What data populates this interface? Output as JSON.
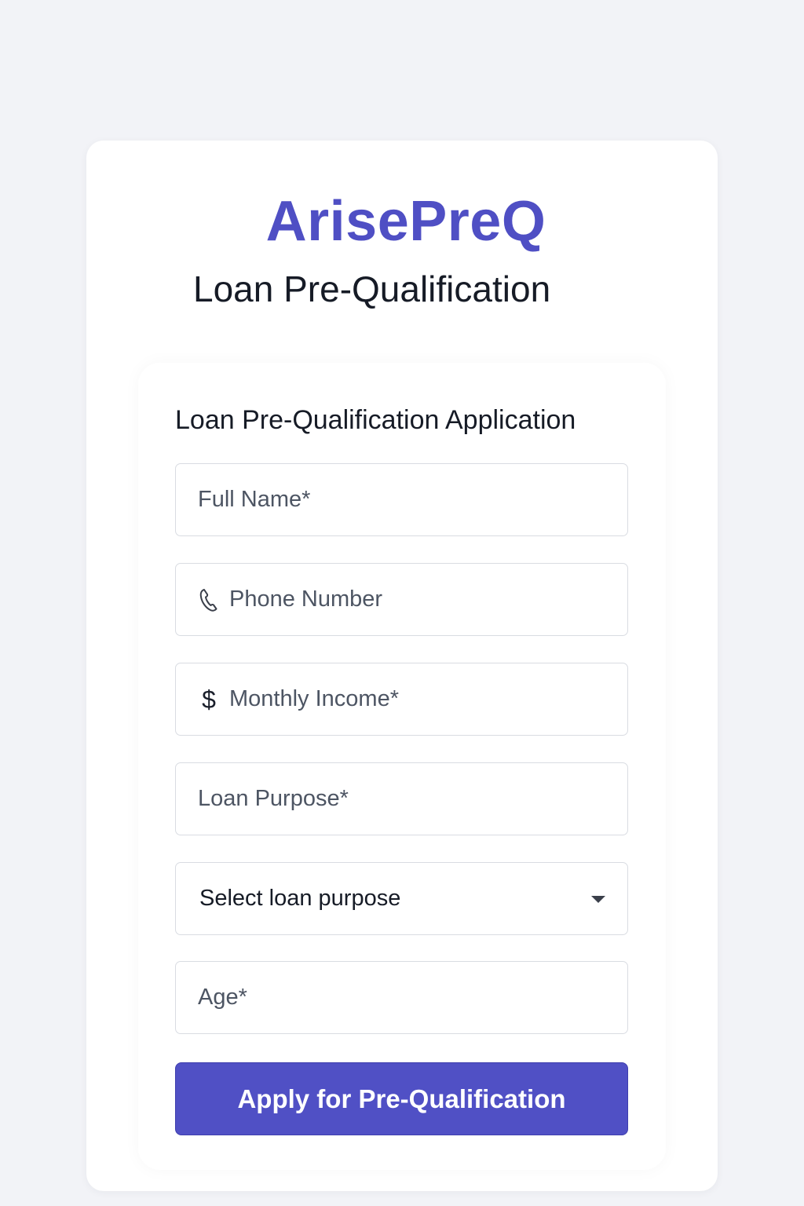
{
  "brand": {
    "name": "ArisePreQ",
    "subtitle": "Loan Pre-Qualification",
    "accent_color": "#4f4fc4"
  },
  "form": {
    "title": "Loan Pre-Qualification Application",
    "fields": {
      "full_name": {
        "placeholder": "Full Name*",
        "value": ""
      },
      "phone": {
        "placeholder": "Phone Number",
        "value": "",
        "icon": "phone-icon"
      },
      "monthly_income": {
        "placeholder": "Monthly Income*",
        "value": "",
        "icon": "dollar-icon"
      },
      "loan_purpose": {
        "placeholder": "Loan Purpose*",
        "value": ""
      },
      "loan_purpose_select": {
        "selected": "Select loan purpose",
        "icon": "chevron-down-icon"
      },
      "age": {
        "placeholder": "Age*",
        "value": ""
      }
    },
    "submit_label": "Apply for Pre-Qualification",
    "submit_color": "#5050c5"
  },
  "icons": {
    "dollar_glyph": "$"
  }
}
